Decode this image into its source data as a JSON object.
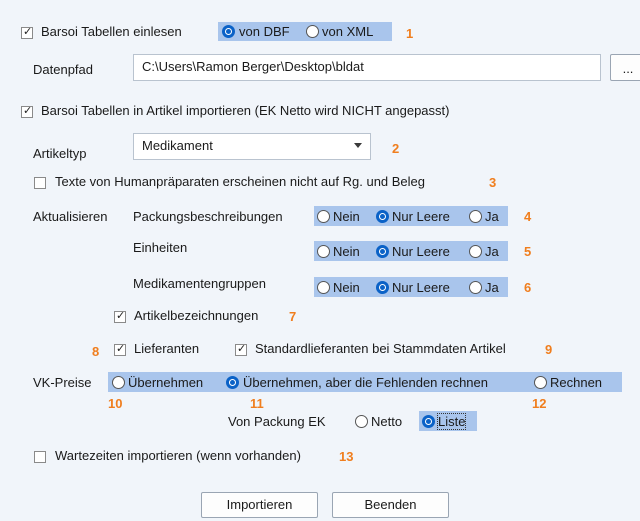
{
  "row1": {
    "label": "Barsoi Tabellen einlesen",
    "radio_dbf": "von DBF",
    "radio_xml": "von XML",
    "num": "1"
  },
  "datapath": {
    "label": "Datenpfad",
    "value": "C:\\Users\\Ramon Berger\\Desktop\\bldat",
    "browse": "..."
  },
  "row2": {
    "label": "Barsoi Tabellen in Artikel importieren (EK Netto wird NICHT angepasst)"
  },
  "artikeltyp": {
    "label": "Artikeltyp",
    "value": "Medikament",
    "num": "2"
  },
  "texte": {
    "label": "Texte von Humanpräparaten erscheinen nicht auf Rg. und Beleg",
    "num": "3"
  },
  "aktualisieren": {
    "label": "Aktualisieren",
    "rows": [
      {
        "label": "Packungsbeschreibungen",
        "nein": "Nein",
        "nur": "Nur Leere",
        "ja": "Ja",
        "num": "4"
      },
      {
        "label": "Einheiten",
        "nein": "Nein",
        "nur": "Nur Leere",
        "ja": "Ja",
        "num": "5"
      },
      {
        "label": "Medikamentengruppen",
        "nein": "Nein",
        "nur": "Nur Leere",
        "ja": "Ja",
        "num": "6"
      }
    ]
  },
  "artikelbez": {
    "label": "Artikelbezeichnungen",
    "num": "7"
  },
  "lieferanten": {
    "num_left": "8",
    "label": "Lieferanten",
    "std_label": "Standardlieferanten bei Stammdaten Artikel",
    "num": "9"
  },
  "vkpreise": {
    "label": "VK-Preise",
    "opt1": "Übernehmen",
    "opt2": "Übernehmen, aber die Fehlenden rechnen",
    "opt3": "Rechnen",
    "num1": "10",
    "num2": "11",
    "num3": "12"
  },
  "vonpackung": {
    "label": "Von Packung EK",
    "netto": "Netto",
    "liste": "Liste"
  },
  "wartezeiten": {
    "label": "Wartezeiten importieren (wenn vorhanden)",
    "num": "13"
  },
  "buttons": {
    "import": "Importieren",
    "close": "Beenden"
  },
  "colors": {
    "accent_number": "#f07e1e",
    "highlight": "#a9c5ec",
    "radio_on": "#0b62c7"
  }
}
